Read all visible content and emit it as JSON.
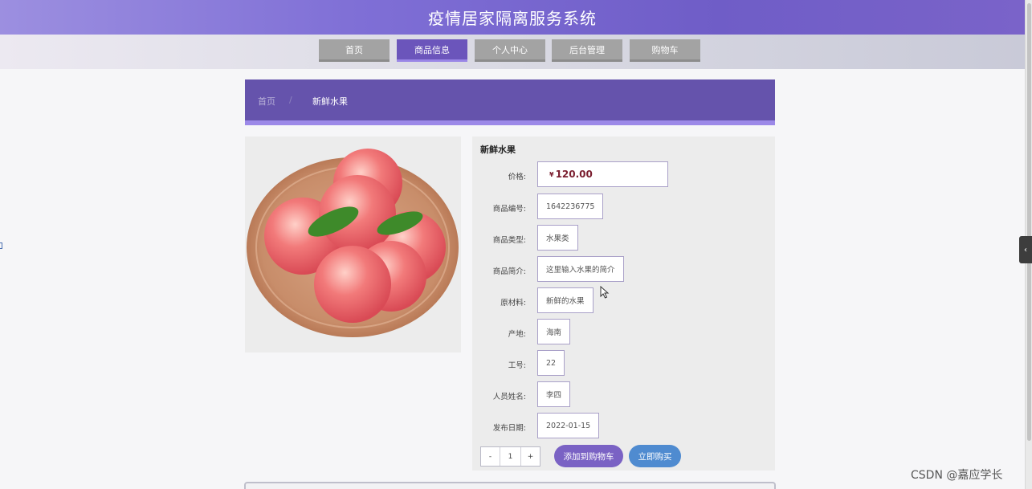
{
  "header": {
    "title": "疫情居家隔离服务系统"
  },
  "nav": {
    "items": [
      {
        "label": "首页",
        "active": false
      },
      {
        "label": "商品信息",
        "active": true
      },
      {
        "label": "个人中心",
        "active": false
      },
      {
        "label": "后台管理",
        "active": false
      },
      {
        "label": "购物车",
        "active": false
      }
    ]
  },
  "breadcrumb": {
    "home": "首页",
    "separator": "/",
    "current": "新鲜水果"
  },
  "product": {
    "name": "新鲜水果",
    "image_icon": "peaches-on-plate",
    "price_currency": "¥",
    "price_value": "120.00",
    "fields": [
      {
        "label": "价格:",
        "value": ""
      },
      {
        "label": "商品编号:",
        "value": "1642236775"
      },
      {
        "label": "商品类型:",
        "value": "水果类"
      },
      {
        "label": "商品简介:",
        "value": "这里输入水果的简介"
      },
      {
        "label": "原材料:",
        "value": "新鲜的水果"
      },
      {
        "label": "产地:",
        "value": "海南"
      },
      {
        "label": "工号:",
        "value": "22"
      },
      {
        "label": "人员姓名:",
        "value": "李四"
      },
      {
        "label": "发布日期:",
        "value": "2022-01-15"
      }
    ]
  },
  "quantity": {
    "minus": "-",
    "value": "1",
    "plus": "+"
  },
  "actions": {
    "add_to_cart": "添加到购物车",
    "buy_now": "立即购买"
  },
  "watermark": "CSDN @嘉应学长",
  "colors": {
    "header": "#7f6fd6",
    "active_nav": "#6b55bb",
    "breadcrumb": "#6553ac",
    "price": "#7a1d2e",
    "buy_button": "#4f8bd0"
  }
}
